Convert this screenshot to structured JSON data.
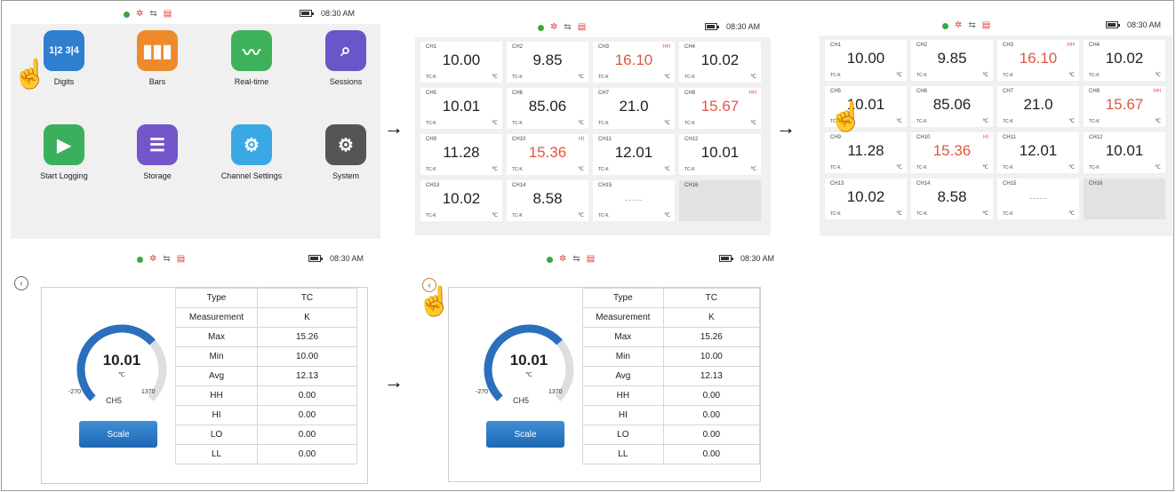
{
  "status": {
    "time": "08:30 AM"
  },
  "home": {
    "apps": [
      {
        "label": "Digits",
        "icon": "digits-icon",
        "color": "#2f7fd1",
        "glyph": "1|2 3|4"
      },
      {
        "label": "Bars",
        "icon": "bars-icon",
        "color": "#ef8a2c",
        "glyph": "▮▮▮"
      },
      {
        "label": "Real-time",
        "icon": "realtime-icon",
        "color": "#3db25a",
        "glyph": "〰"
      },
      {
        "label": "Sessions",
        "icon": "sessions-icon",
        "color": "#6a55c9",
        "glyph": "⌕"
      },
      {
        "label": "Start Logging",
        "icon": "play-icon",
        "color": "#3bb05c",
        "glyph": "▶"
      },
      {
        "label": "Storage",
        "icon": "storage-icon",
        "color": "#7356c9",
        "glyph": "☰"
      },
      {
        "label": "Channel Settings",
        "icon": "channel-settings-icon",
        "color": "#3ba8e6",
        "glyph": "⚙"
      },
      {
        "label": "System",
        "icon": "system-icon",
        "color": "#555555",
        "glyph": "⚙"
      }
    ]
  },
  "channels": [
    {
      "ch": "CH1",
      "value": "10.00",
      "tc": "TC-K",
      "unit": "℃",
      "alarm": "",
      "red": false
    },
    {
      "ch": "CH2",
      "value": "9.85",
      "tc": "TC-K",
      "unit": "℃",
      "alarm": "",
      "red": false
    },
    {
      "ch": "CH3",
      "value": "16.10",
      "tc": "TC-K",
      "unit": "℃",
      "alarm": "HH",
      "red": true
    },
    {
      "ch": "CH4",
      "value": "10.02",
      "tc": "TC-K",
      "unit": "℃",
      "alarm": "",
      "red": false
    },
    {
      "ch": "CH5",
      "value": "10.01",
      "tc": "TC-K",
      "unit": "℃",
      "alarm": "",
      "red": false
    },
    {
      "ch": "CH6",
      "value": "85.06",
      "tc": "TC-K",
      "unit": "℃",
      "alarm": "",
      "red": false
    },
    {
      "ch": "CH7",
      "value": "21.0",
      "tc": "TC-K",
      "unit": "℃",
      "alarm": "",
      "red": false
    },
    {
      "ch": "CH8",
      "value": "15.67",
      "tc": "TC-K",
      "unit": "℃",
      "alarm": "HH",
      "red": true
    },
    {
      "ch": "CH9",
      "value": "11.28",
      "tc": "TC-K",
      "unit": "℃",
      "alarm": "",
      "red": false
    },
    {
      "ch": "CH10",
      "value": "15.36",
      "tc": "TC-K",
      "unit": "℃",
      "alarm": "HI",
      "red": true
    },
    {
      "ch": "CH11",
      "value": "12.01",
      "tc": "TC-K",
      "unit": "℃",
      "alarm": "",
      "red": false
    },
    {
      "ch": "CH12",
      "value": "10.01",
      "tc": "TC-K",
      "unit": "℃",
      "alarm": "",
      "red": false
    },
    {
      "ch": "CH13",
      "value": "10.02",
      "tc": "TC-K",
      "unit": "℃",
      "alarm": "",
      "red": false
    },
    {
      "ch": "CH14",
      "value": "8.58",
      "tc": "TC-K",
      "unit": "℃",
      "alarm": "",
      "red": false
    },
    {
      "ch": "CH15",
      "value": "-----",
      "tc": "TC-K",
      "unit": "℃",
      "alarm": "",
      "red": false
    },
    {
      "ch": "CH16",
      "value": "",
      "tc": "",
      "unit": "",
      "alarm": "",
      "red": false
    }
  ],
  "detail": {
    "value": "10.01",
    "unit": "℃",
    "min_scale": "-270",
    "max_scale": "1370",
    "channel": "CH5",
    "gauge_fraction": 0.68,
    "scale_label": "Scale",
    "rows": [
      {
        "k": "Type",
        "v": "TC"
      },
      {
        "k": "Measurement",
        "v": "K"
      },
      {
        "k": "Max",
        "v": "15.26"
      },
      {
        "k": "Min",
        "v": "10.00"
      },
      {
        "k": "Avg",
        "v": "12.13"
      },
      {
        "k": "HH",
        "v": "0.00"
      },
      {
        "k": "HI",
        "v": "0.00"
      },
      {
        "k": "LO",
        "v": "0.00"
      },
      {
        "k": "LL",
        "v": "0.00"
      }
    ]
  }
}
